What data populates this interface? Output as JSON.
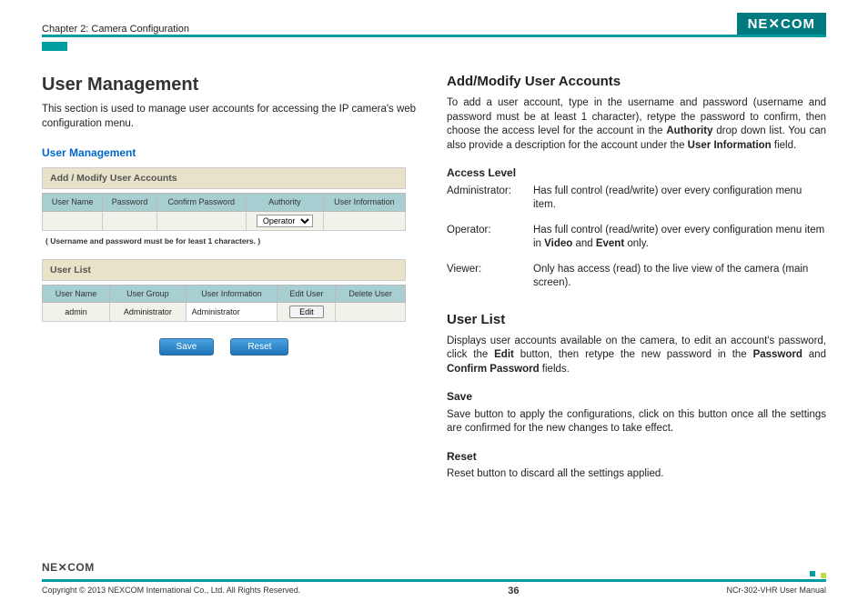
{
  "header": {
    "chapter": "Chapter 2: Camera Configuration",
    "brand": "NEXCOM"
  },
  "left": {
    "title": "User Management",
    "intro": "This section is used to manage user accounts for accessing the IP camera's web configuration menu.",
    "ss": {
      "heading": "User Management",
      "section1": "Add / Modify User Accounts",
      "cols1": [
        "User Name",
        "Password",
        "Confirm Password",
        "Authority",
        "User Information"
      ],
      "authority_options": [
        "Operator"
      ],
      "note": "( Username and password must be for least 1 characters. )",
      "section2": "User List",
      "cols2": [
        "User Name",
        "User Group",
        "User Information",
        "Edit User",
        "Delete User"
      ],
      "row": {
        "username": "admin",
        "usergroup": "Administrator",
        "userinfo": "Administrator",
        "edit_label": "Edit"
      },
      "save_label": "Save",
      "reset_label": "Reset"
    }
  },
  "right": {
    "title": "Add/Modify User Accounts",
    "intro_pre": "To add a user account, type in the username and password (username and password must be at least 1 character), retype the password to confirm, then choose the access level for the account in the ",
    "intro_b1": "Authority",
    "intro_mid": " drop down list. You can also provide a description for the account under the ",
    "intro_b2": "User Information",
    "intro_post": " field.",
    "access_level_title": "Access Level",
    "access_levels": [
      {
        "label": "Administrator:",
        "desc": "Has full control (read/write) over every configuration menu item."
      },
      {
        "label": "Operator:",
        "desc_pre": "Has full control (read/write) over every configuration menu item in ",
        "b1": "Video",
        "mid": " and ",
        "b2": "Event",
        "post": " only."
      },
      {
        "label": "Viewer:",
        "desc": "Only has access (read) to the live view of the camera (main screen)."
      }
    ],
    "userlist_title": "User List",
    "userlist_pre": "Displays user accounts available on the camera, to edit an account's password, click the ",
    "userlist_b1": "Edit",
    "userlist_mid": " button, then retype the new password in the ",
    "userlist_b2": "Password",
    "userlist_and": " and ",
    "userlist_b3": "Confirm Password",
    "userlist_post": " fields.",
    "save_title": "Save",
    "save_desc": "Save button to apply the configurations, click on this button once all the settings are confirmed for the new changes to take effect.",
    "reset_title": "Reset",
    "reset_desc": "Reset button to discard all the settings applied."
  },
  "footer": {
    "brand": "NEXCOM",
    "copyright": "Copyright © 2013 NEXCOM International Co., Ltd. All Rights Reserved.",
    "page": "36",
    "doc": "NCr-302-VHR User Manual"
  }
}
